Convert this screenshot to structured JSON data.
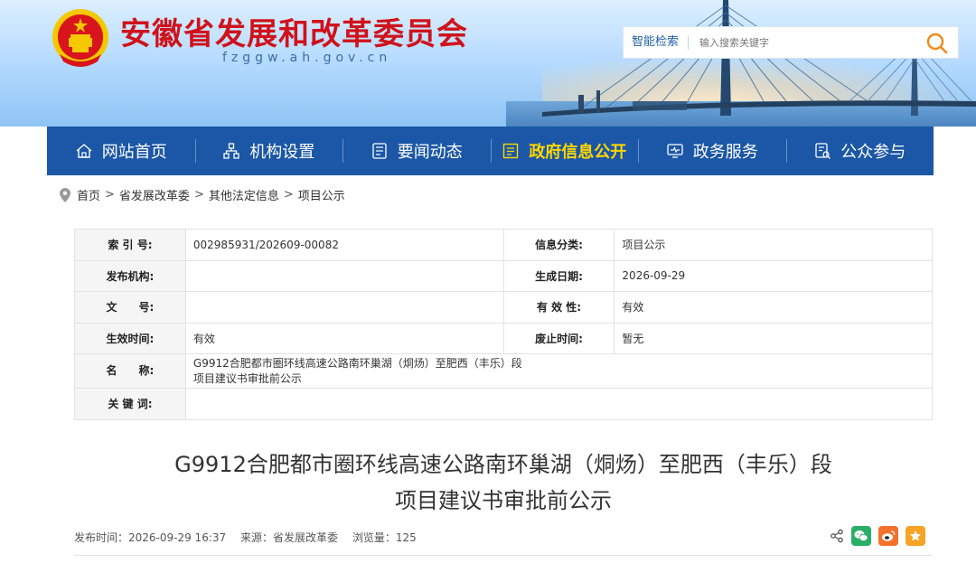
{
  "header": {
    "site_title": "安徽省发展和改革委员会",
    "domain": "fzggw.ah.gov.cn",
    "search": {
      "label": "智能检索",
      "placeholder": "输入搜索关键字"
    }
  },
  "nav": {
    "items": [
      {
        "label": "网站首页",
        "icon": "home-icon"
      },
      {
        "label": "机构设置",
        "icon": "org-chart-icon"
      },
      {
        "label": "要闻动态",
        "icon": "news-icon"
      },
      {
        "label": "政府信息公开",
        "icon": "info-board-icon",
        "active": true
      },
      {
        "label": "政务服务",
        "icon": "monitor-icon"
      },
      {
        "label": "公众参与",
        "icon": "participation-icon"
      }
    ],
    "active_color": "#ffd700",
    "bg_color": "#1b57a6"
  },
  "breadcrumb": [
    "首页",
    "省发展改革委",
    "其他法定信息",
    "项目公示"
  ],
  "info": {
    "index_label": "索 引 号:",
    "index_value": "002985931/202609-00082",
    "category_label": "信息分类:",
    "category_value": "项目公示",
    "publisher_label": "发布机构:",
    "publisher_value": "",
    "date_label": "生成日期:",
    "date_value": "2026-09-29",
    "docno_label": "文　　号:",
    "docno_value": "",
    "validity_label": "有 效 性:",
    "validity_value": "有效",
    "effective_label": "生效时间:",
    "effective_value": "有效",
    "abolish_label": "废止时间:",
    "abolish_value": "暂无",
    "name_label": "名　　称:",
    "name_value_line1": "G9912合肥都市圈环线高速公路南环巢湖（烔炀）至肥西（丰乐）段",
    "name_value_line2": "项目建议书审批前公示",
    "keywords_label": "关 键 词:",
    "keywords_value": ""
  },
  "article": {
    "title_line1": "G9912合肥都市圈环线高速公路南环巢湖（烔炀）至肥西（丰乐）段",
    "title_line2": "项目建议书审批前公示",
    "publish_time": "发布时间：2026-09-29 16:37",
    "source": "来源：省发展改革委",
    "views": "浏览量：125"
  },
  "colors": {
    "title_red": "#d0121b",
    "nav_blue": "#1b57a6",
    "wechat_green": "#2aae67",
    "weibo_orange": "#f4702b",
    "favorite_orange": "#f7a325"
  }
}
